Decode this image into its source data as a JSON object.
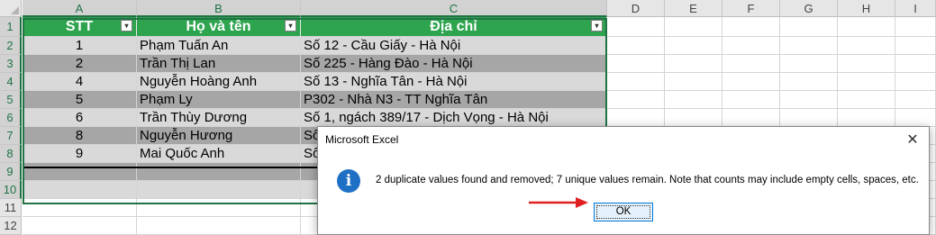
{
  "sheet": {
    "column_headers": [
      "A",
      "B",
      "C",
      "D",
      "E",
      "F",
      "G",
      "H",
      "I"
    ],
    "row_headers": [
      "1",
      "2",
      "3",
      "4",
      "5",
      "6",
      "7",
      "8",
      "9",
      "10",
      "11",
      "12"
    ],
    "table_headers": [
      "STT",
      "Họ và tên",
      "Địa chỉ"
    ],
    "filter_arrow": "▾",
    "rows": [
      [
        "1",
        "Phạm Tuấn An",
        "Số 12 - Cầu Giấy - Hà Nội"
      ],
      [
        "2",
        "Trần Thị Lan",
        "Số 225 - Hàng Đào - Hà Nội"
      ],
      [
        "4",
        "Nguyễn Hoàng Anh",
        "Số 13 - Nghĩa Tân - Hà Nội"
      ],
      [
        "5",
        "Phạm Ly",
        "P302 - Nhà N3 - TT Nghĩa Tân"
      ],
      [
        "6",
        "Trần Thùy Dương",
        "Số 1, ngách 389/17 - Dịch Vọng - Hà Nội"
      ],
      [
        "8",
        "Nguyễn Hương",
        "Số"
      ],
      [
        "9",
        "Mai Quốc Anh",
        "Số"
      ],
      [
        "",
        "",
        ""
      ],
      [
        "",
        "",
        ""
      ]
    ]
  },
  "dialog": {
    "title": "Microsoft Excel",
    "close_glyph": "✕",
    "info_glyph": "i",
    "message": "2 duplicate values found and removed; 7 unique values remain. Note that counts may include empty cells, spaces, etc.",
    "ok_label": "OK"
  },
  "colors": {
    "header_green": "#2ea44f",
    "band_dark": "#a6a6a6",
    "band_light": "#d9d9d9",
    "selection": "#217346",
    "arrow_red": "#e02020",
    "info_blue": "#1f6fc5"
  }
}
